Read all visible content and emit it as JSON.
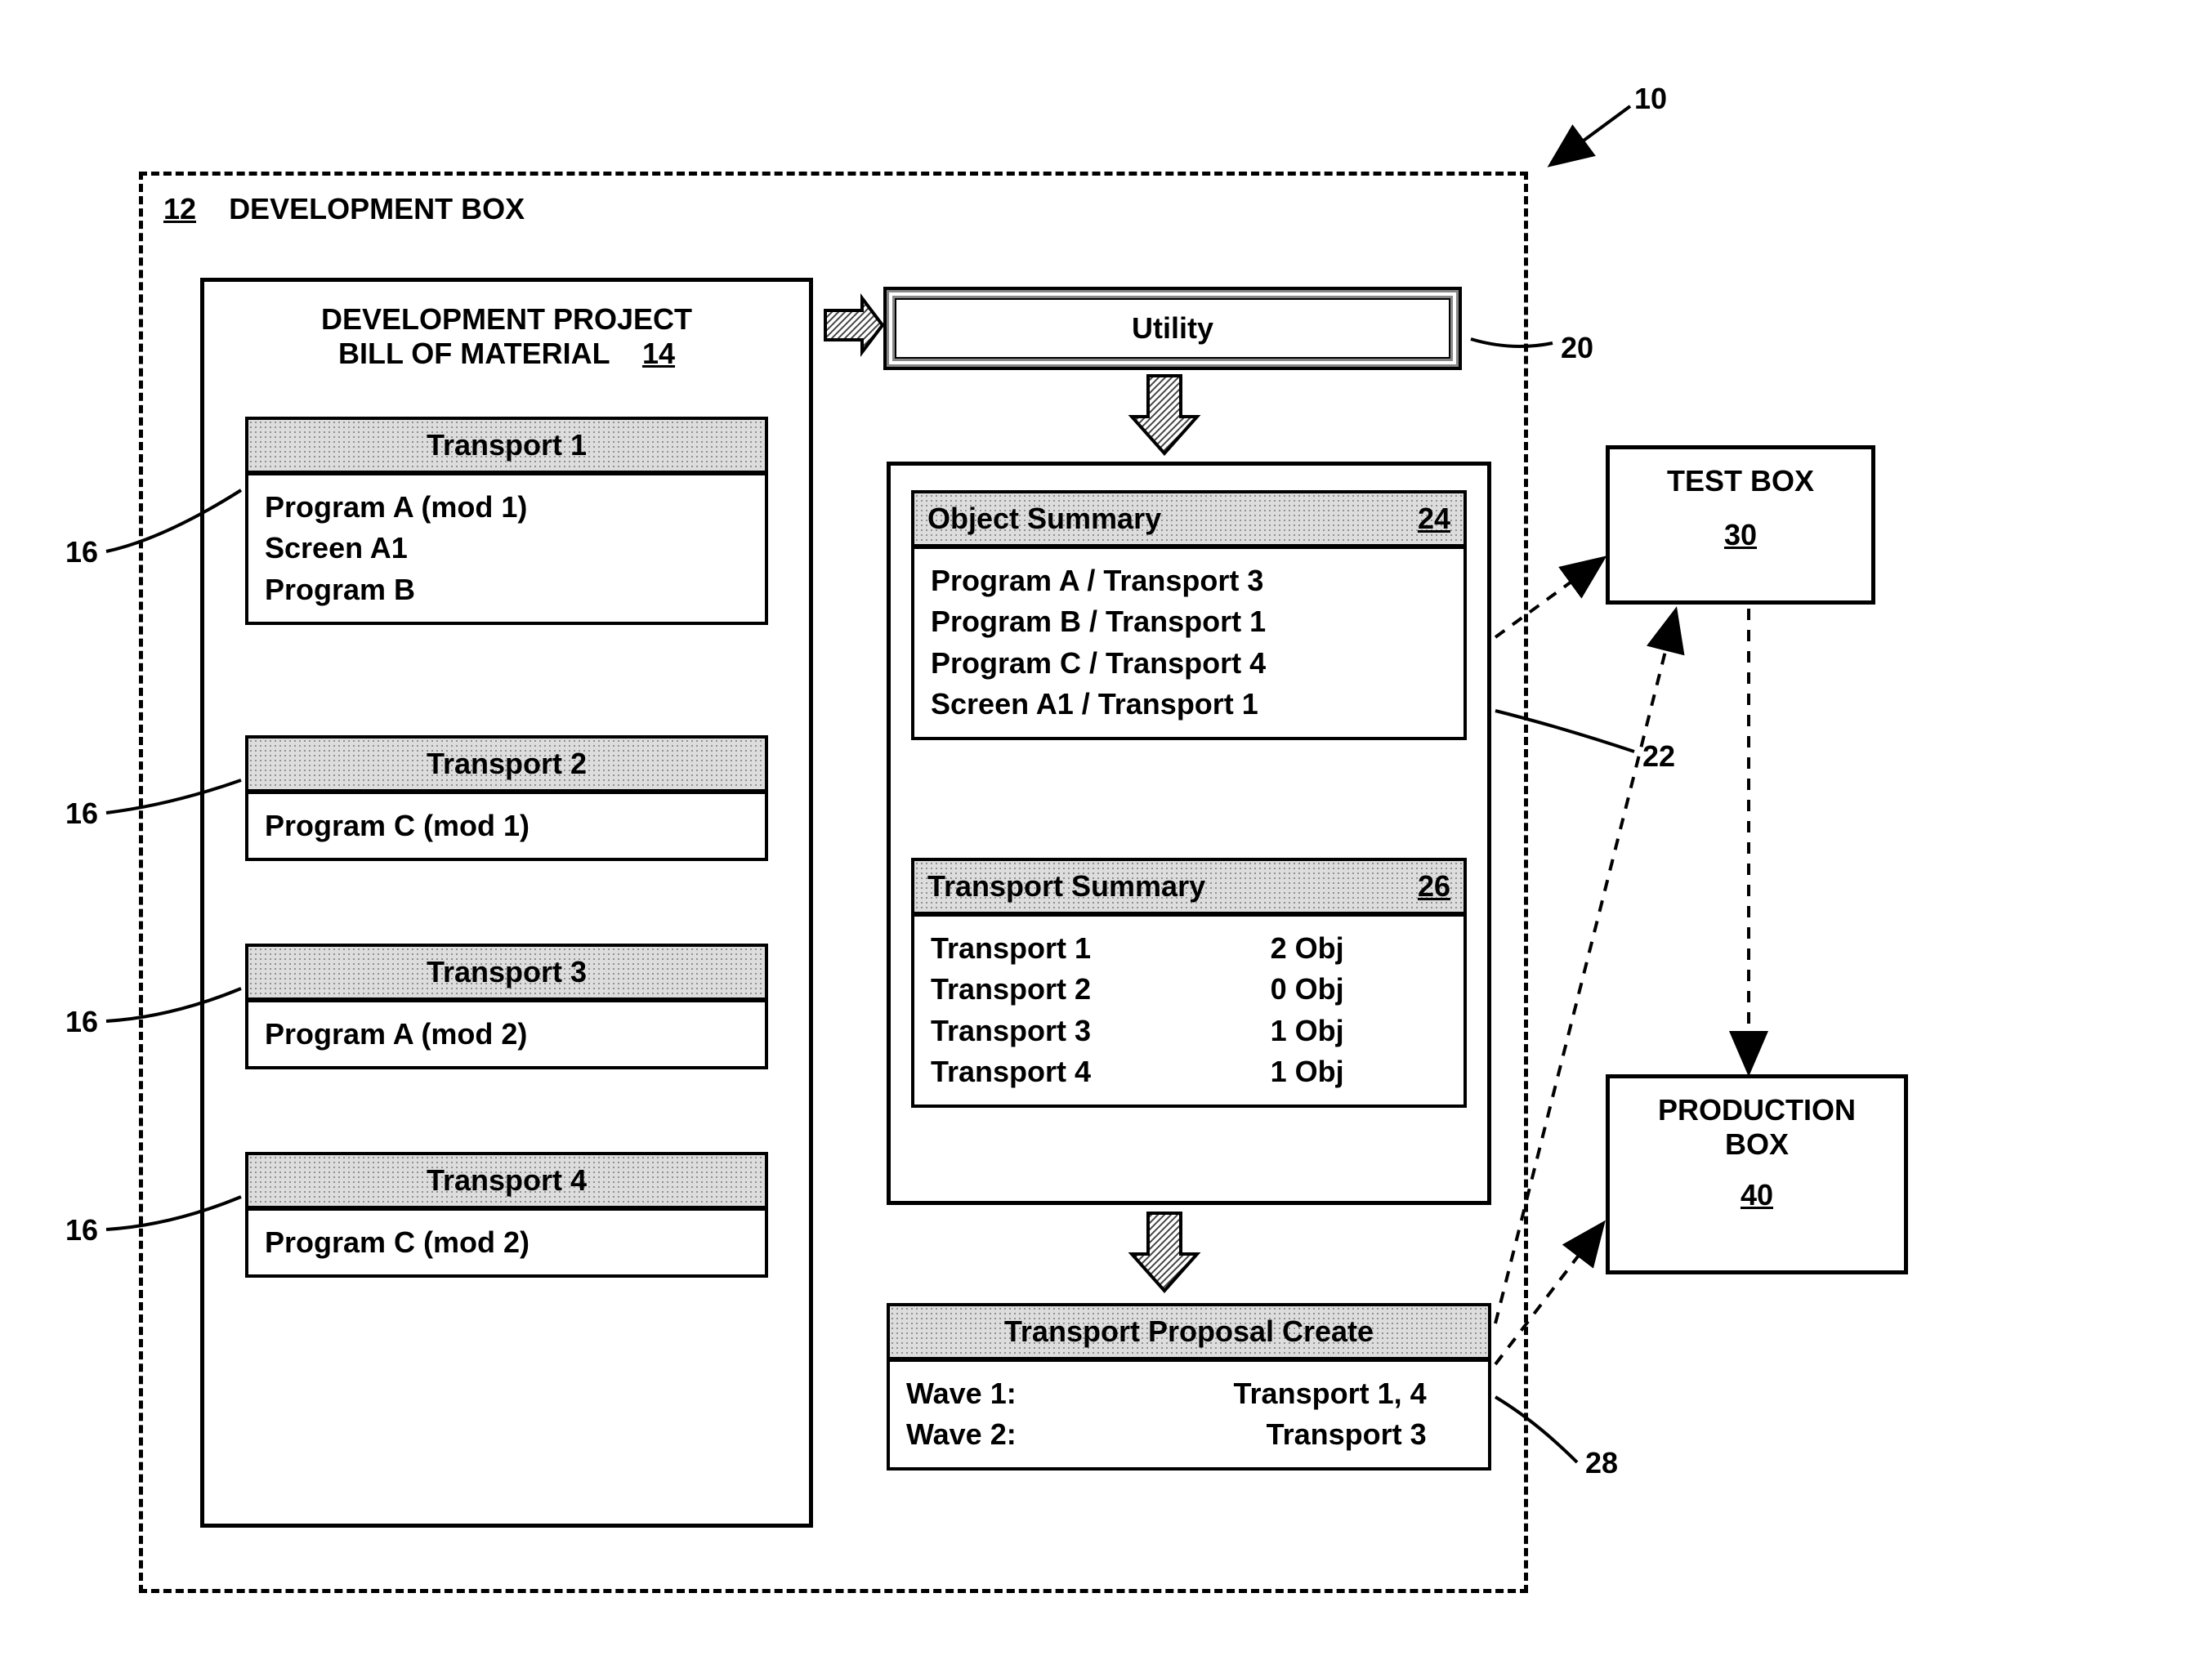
{
  "refs": {
    "system": "10",
    "devbox": "12",
    "bom": "14",
    "t1": "16",
    "t2": "16",
    "t3": "16",
    "t4": "16",
    "utility": "20",
    "summarybox": "22",
    "objsum": "24",
    "tsum": "26",
    "proposal": "28",
    "testbox": "30",
    "prodbox": "40"
  },
  "titles": {
    "devbox": "DEVELOPMENT BOX",
    "bom_line1": "DEVELOPMENT PROJECT",
    "bom_line2": "BILL OF MATERIAL",
    "utility": "Utility",
    "objsum": "Object Summary",
    "tsum": "Transport Summary",
    "proposal": "Transport Proposal Create",
    "testbox": "TEST BOX",
    "prodbox_line1": "PRODUCTION",
    "prodbox_line2": "BOX"
  },
  "transports": [
    {
      "name": "Transport 1",
      "items": [
        "Program A (mod 1)",
        "Screen A1",
        "Program B"
      ]
    },
    {
      "name": "Transport 2",
      "items": [
        "Program C (mod 1)"
      ]
    },
    {
      "name": "Transport 3",
      "items": [
        "Program A (mod 2)"
      ]
    },
    {
      "name": "Transport 4",
      "items": [
        "Program C (mod 2)"
      ]
    }
  ],
  "object_summary": [
    "Program A / Transport 3",
    "Program B / Transport 1",
    "Program C / Transport 4",
    "Screen A1 / Transport 1"
  ],
  "transport_summary": [
    {
      "name": "Transport 1",
      "count": "2 Obj"
    },
    {
      "name": "Transport 2",
      "count": "0 Obj"
    },
    {
      "name": "Transport 3",
      "count": "1 Obj"
    },
    {
      "name": "Transport 4",
      "count": "1 Obj"
    }
  ],
  "proposal": [
    {
      "wave": "Wave 1:",
      "val": "Transport 1, 4"
    },
    {
      "wave": "Wave 2:",
      "val": "Transport 3"
    }
  ]
}
